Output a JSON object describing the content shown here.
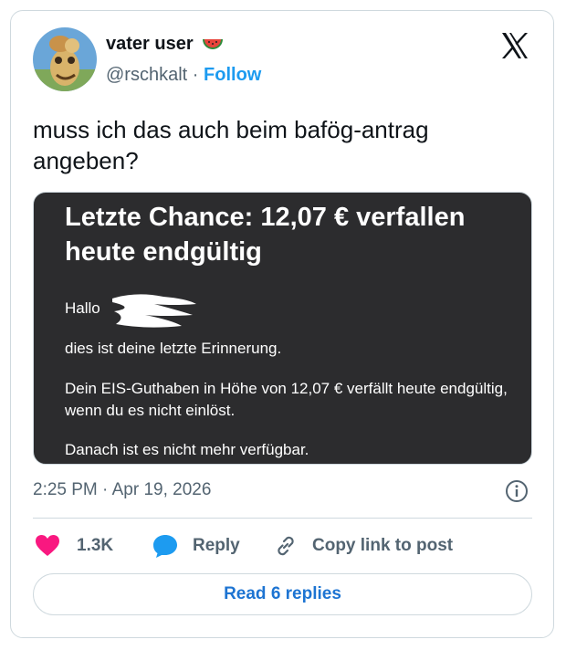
{
  "user": {
    "display_name": "vater user",
    "name_emoji": "watermelon-emoji",
    "handle": "@rschkalt",
    "separator": "·",
    "follow_label": "Follow"
  },
  "tweet": {
    "text": "muss ich das auch beim bafög-antrag angeben?",
    "timestamp": "2:25 PM · Apr 19, 2026"
  },
  "media": {
    "title": "Letzte Chance: 12,07 € verfallen heute endgültig",
    "greeting": "Hallo",
    "line1": "dies ist deine letzte Erinnerung.",
    "line2": "Dein EIS-Guthaben in Höhe von 12,07 € verfällt heute endgültig, wenn du es nicht einlöst.",
    "line3": "Danach ist es nicht mehr verfügbar."
  },
  "actions": {
    "likes": "1.3K",
    "reply_label": "Reply",
    "copy_label": "Copy link to post"
  },
  "read_replies_label": "Read 6 replies",
  "colors": {
    "accent": "#1d9bf0",
    "like": "#f91880",
    "media_bg": "#2c2c2e",
    "muted": "#536471"
  }
}
